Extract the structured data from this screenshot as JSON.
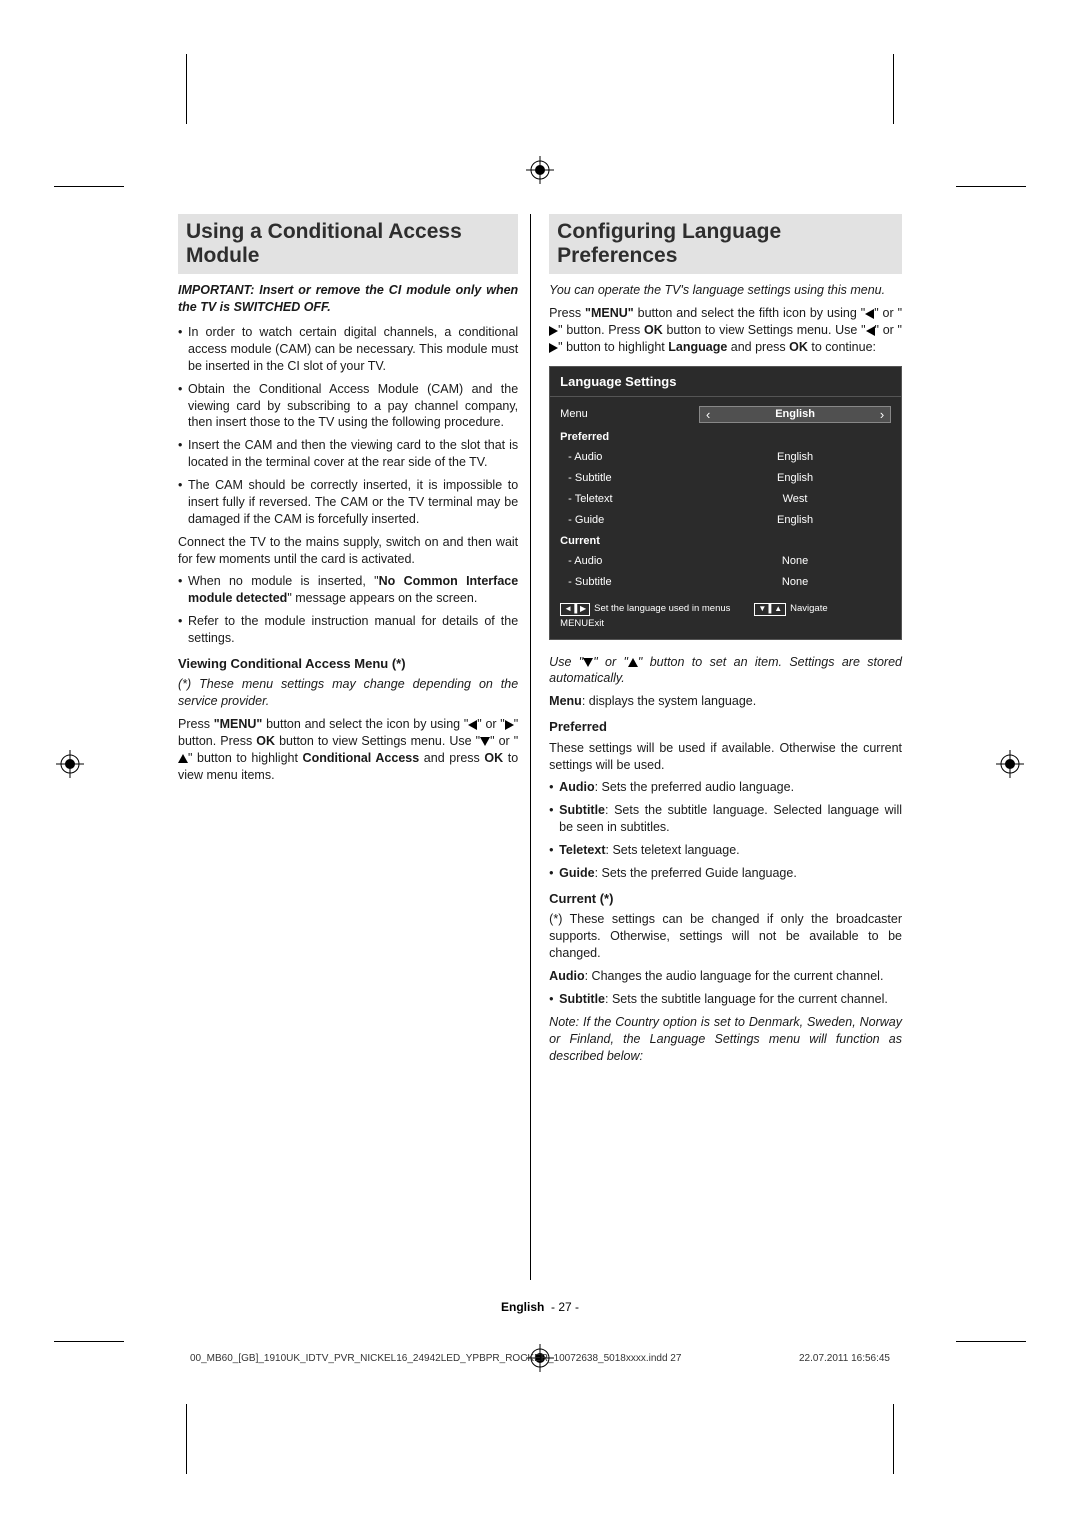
{
  "left": {
    "heading": "Using a Conditional Access Module",
    "important": "IMPORTANT: Insert or remove the CI module only when the TV is SWITCHED OFF.",
    "bullets1": [
      "In order to watch certain digital channels, a conditional access module (CAM) can be necessary. This module must be inserted in the CI slot of your TV.",
      "Obtain the Conditional Access Module (CAM) and the viewing card by subscribing to a pay channel company, then insert those to the TV using the following procedure.",
      "Insert the CAM and then the viewing card to the slot that is located in the terminal cover at the rear side of the TV.",
      "The CAM should be correctly inserted, it is impossible to insert fully if reversed. The CAM or the TV terminal may be damaged if the CAM is forcefully inserted."
    ],
    "para_connect": "Connect the TV to the mains supply, switch on and then wait for few moments until the card is activated.",
    "bullets2_pre": "When no module is inserted, \"",
    "bullets2_bold": "No Common Interface module detected",
    "bullets2_post": "\" message appears on the screen.",
    "bullets3": "Refer to the module instruction manual for details of the settings.",
    "sub_heading": "Viewing Conditional Access Menu (*)",
    "sub_note": "(*) These menu settings may change depending on the service provider.",
    "press_pre": "Press ",
    "press_menu": "\"MENU\"",
    "press_mid": " button and select the icon by using \"",
    "press_mid2": "\" or \"",
    "press_mid3": "\" button. Press ",
    "press_ok": "OK",
    "press_mid4": " button to view Settings menu. Use \"",
    "press_mid5": "\" or \"",
    "press_mid6": "\" button to highlight ",
    "press_cond": "Conditional Access",
    "press_mid7": " and press ",
    "press_end": " to view menu items."
  },
  "right": {
    "heading": "Configuring Language Preferences",
    "intro": "You can operate the TV's language settings using this menu.",
    "press_pre": "Press ",
    "press_menu": "\"MENU\"",
    "press_mid": " button and select the fifth icon by using \"",
    "press_mid2": "\" or \"",
    "press_mid3": "\" button. Press ",
    "press_ok": "OK",
    "press_mid4": " button to view Settings menu. Use \"",
    "press_mid5": "\" or \"",
    "press_mid6": "\" button to highlight ",
    "press_lang": "Language",
    "press_mid7": " and press ",
    "press_end": " to continue:",
    "osd": {
      "title": "Language Settings",
      "menu_label": "Menu",
      "menu_value": "English",
      "group_pref": "Preferred",
      "rows_pref": [
        {
          "label": "- Audio",
          "value": "English"
        },
        {
          "label": "- Subtitle",
          "value": "English"
        },
        {
          "label": "- Teletext",
          "value": "West"
        },
        {
          "label": "- Guide",
          "value": "English"
        }
      ],
      "group_cur": "Current",
      "rows_cur": [
        {
          "label": "- Audio",
          "value": "None"
        },
        {
          "label": "- Subtitle",
          "value": "None"
        }
      ],
      "hint1": "Set the language used in menus",
      "hint2": "Navigate",
      "hint3_box": "MENU",
      "hint3": "Exit"
    },
    "use_pre": "Use \"",
    "use_mid": "\" or \"",
    "use_end": "\" button to set an item. Settings are stored automatically.",
    "menu_b": "Menu",
    "menu_t": ": displays the system language.",
    "pref_h": "Preferred",
    "pref_p": "These settings will be used if available. Otherwise the current settings will be used.",
    "pref_items": [
      {
        "b": "Audio",
        "t": ": Sets the preferred audio language."
      },
      {
        "b": "Subtitle",
        "t": ": Sets the subtitle language. Selected language will be seen in subtitles."
      },
      {
        "b": "Teletext",
        "t": ": Sets teletext language."
      },
      {
        "b": "Guide",
        "t": ": Sets the preferred Guide language."
      }
    ],
    "cur_h": "Current (*)",
    "cur_p": "(*) These settings can be changed if only the broadcaster supports. Otherwise, settings will not be available to be changed.",
    "cur_audio_b": "Audio",
    "cur_audio_t": ": Changes the audio language for the current channel.",
    "cur_sub_b": "Subtitle",
    "cur_sub_t": ": Sets the subtitle language for the current channel.",
    "note": "Note: If the Country option is set to Denmark, Sweden, Norway or Finland, the Language Settings menu will function as described below:"
  },
  "footer": {
    "lang": "English",
    "page": "- 27 -"
  },
  "printline": {
    "left": "00_MB60_[GB]_1910UK_IDTV_PVR_NICKEL16_24942LED_YPBPR_ROCKER_10072638_5018xxxx.indd   27",
    "right": "22.07.2011   16:56:45"
  }
}
